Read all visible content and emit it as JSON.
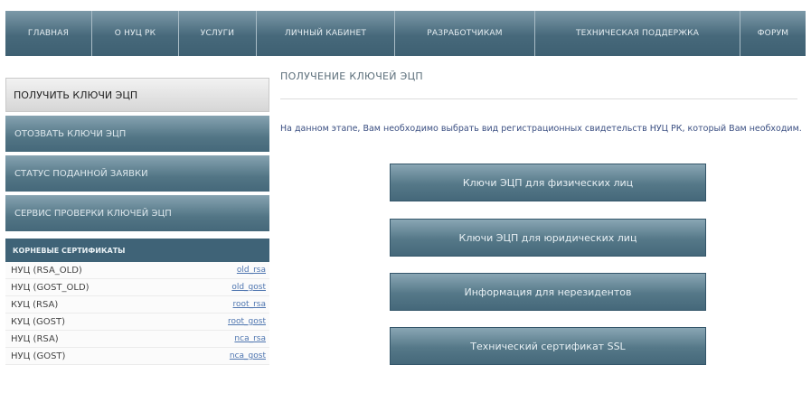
{
  "topnav": [
    {
      "label": "ГЛАВНАЯ"
    },
    {
      "label": "О НУЦ РК"
    },
    {
      "label": "УСЛУГИ"
    },
    {
      "label": "ЛИЧНЫЙ КАБИНЕТ"
    },
    {
      "label": "РАЗРАБОТЧИКАМ"
    },
    {
      "label": "ТЕХНИЧЕСКАЯ ПОДДЕРЖКА"
    },
    {
      "label": "ФОРУМ"
    }
  ],
  "sidebar": {
    "active_item": "ПОЛУЧИТЬ КЛЮЧИ ЭЦП",
    "items": [
      {
        "label": "ОТОЗВАТЬ КЛЮЧИ ЭЦП"
      },
      {
        "label": "СТАТУС ПОДАННОЙ ЗАЯВКИ"
      },
      {
        "label": "СЕРВИС ПРОВЕРКИ КЛЮЧЕЙ ЭЦП"
      }
    ],
    "root_certs_header": "КОРНЕВЫЕ СЕРТИФИКАТЫ",
    "certs": [
      {
        "name": "НУЦ (RSA_OLD)",
        "link": "old_rsa"
      },
      {
        "name": "НУЦ (GOST_OLD)",
        "link": "old_gost"
      },
      {
        "name": "КУЦ (RSA)",
        "link": "root_rsa"
      },
      {
        "name": "КУЦ (GOST)",
        "link": "root_gost"
      },
      {
        "name": "НУЦ (RSA)",
        "link": "nca_rsa"
      },
      {
        "name": "НУЦ (GOST)",
        "link": "nca_gost"
      }
    ]
  },
  "main": {
    "title": "ПОЛУЧЕНИЕ КЛЮЧЕЙ ЭЦП",
    "description": "На данном этапе, Вам необходимо выбрать вид регистрационных свидетельств НУЦ РК, который Вам необходим.",
    "buttons": [
      {
        "label": "Ключи ЭЦП для физических лиц"
      },
      {
        "label": "Ключи ЭЦП для юридических лиц"
      },
      {
        "label": "Информация для нерезидентов"
      },
      {
        "label": "Технический сертификат SSL"
      }
    ]
  }
}
